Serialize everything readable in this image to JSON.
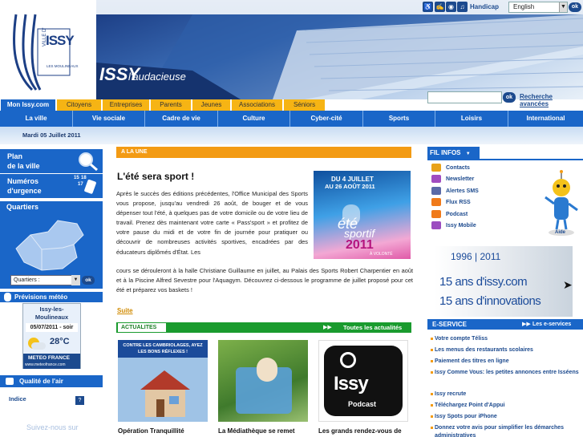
{
  "header": {
    "logo_text": "ISSY",
    "logo_sub": "LES MOULINEAUX",
    "logo_ville": "VILLE D'",
    "slogan": "ISSY",
    "slogan_sub": "l'audacieuse",
    "handicap_label": "Handicap",
    "language": "English",
    "lang_ok": "ok",
    "search_ok": "ok",
    "advanced_search": "Recherche avancées"
  },
  "audience_tabs": [
    "Mon Issy.com",
    "Citoyens",
    "Entreprises",
    "Parents",
    "Jeunes",
    "Associations",
    "Séniors"
  ],
  "nav": [
    "La ville",
    "Vie sociale",
    "Cadre de vie",
    "Culture",
    "Cyber-cité",
    "Sports",
    "Loisirs",
    "International"
  ],
  "date": "Mardi 05 Juillet 2011",
  "left": {
    "plan": [
      "Plan",
      "de la ville"
    ],
    "numeros": [
      "Numéros",
      "d'urgence"
    ],
    "numeros_icon": [
      "15",
      "18",
      "17"
    ],
    "quartiers_title": "Quartiers",
    "quartier_select": "Quartiers :",
    "quartier_ok": "ok",
    "meteo_title": "Prévisions météo",
    "meteo_city": "Issy-les-Moulineaux",
    "meteo_date": "05/07/2011 - soir",
    "meteo_temp": "28°C",
    "meteo_brand": "METEO FRANCE",
    "meteo_url": "www.meteofrance.com",
    "air_title": "Qualité de l'air",
    "indice": "Indice",
    "indice_help": "?",
    "follow": "Suivez-nous sur"
  },
  "une": {
    "header": "A LA UNE",
    "title": "L'été sera sport !",
    "body1": "Après le succès des éditions précédentes, l'Office Municipal des Sports vous propose, jusqu'au vendredi 26 août, de bouger et de vous dépenser tout l'été, à quelques pas de votre domicile ou de votre lieu de travail. Prenez dès maintenant votre carte « Pass'sport » et profitez de votre pause du midi et de votre fin de journée pour pratiquer ou découvrir de nombreuses activités sportives, encadrées par des éducateurs diplômés d'État. Les",
    "body2": "cours se dérouleront à la halle Christiane Guillaume en juillet, au Palais des Sports Robert Charpentier en août et à la Piscine Alfred Sevestre pour l'Aquagym. Découvrez ci-dessous le programme de juillet proposé pour cet été et préparez vos baskets !",
    "poster_dates": "DU 4 JUILLET",
    "poster_dates2": "AU 26 AOÛT 2011",
    "poster_title": "été",
    "poster_title2": "sportif",
    "poster_year": "2011",
    "poster_cap": "À VOLONTÉ",
    "more": "Suite"
  },
  "actu": {
    "header": "ACTUALITES",
    "all": "Toutes les actualités",
    "items": [
      {
        "caption": "Opération Tranquillité",
        "thumb_text": "CONTRE LES CAMBRIOLAGES, AYEZ LES BONS RÉFLEXES !"
      },
      {
        "caption": "La Médiathèque se remet",
        "thumb_text": ""
      },
      {
        "caption": "Les grands rendez-vous de",
        "thumb_text": "Issy Podcast"
      }
    ]
  },
  "fil": {
    "header": "FIL INFOS",
    "items": [
      {
        "label": "Contacts",
        "color": "#e8a21a"
      },
      {
        "label": "Newsletter",
        "color": "#a04cc0"
      },
      {
        "label": "Alertes SMS",
        "color": "#5a6aa8"
      },
      {
        "label": "Flux RSS",
        "color": "#f07a1a"
      },
      {
        "label": "Podcast",
        "color": "#f07a1a"
      },
      {
        "label": "Issy Mobile",
        "color": "#9b4cc0"
      }
    ],
    "mascot_label": "Aide"
  },
  "anniversary": {
    "years": "1996 | 2011",
    "line1": "15 ans d'issy.com",
    "line2": "15 ans d'innovations"
  },
  "eservice": {
    "header": "E-SERVICE",
    "all": "Les e-services",
    "items": [
      "Votre compte Téliss",
      "Les menus des restaurants scolaires",
      "Paiement des titres en ligne",
      "Issy Comme Vous: les petites annonces entre Isséens",
      "Issy recrute",
      "Téléchargez Point d'Appui",
      "Issy Spots pour iPhone",
      "Donnez votre avis pour simplifier les démarches administratives"
    ]
  },
  "colors": {
    "blue": "#1a66c8",
    "orange": "#f39b14",
    "green": "#1a9b2e",
    "tab_yellow": "#f6b414"
  }
}
